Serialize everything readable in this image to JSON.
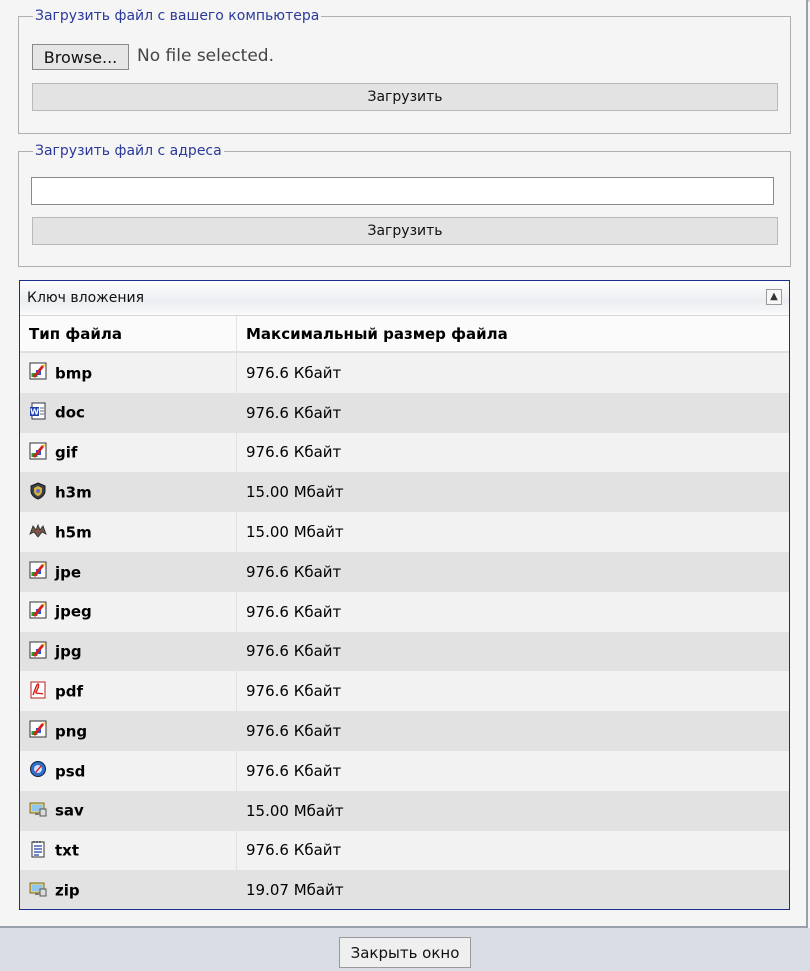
{
  "upload_local": {
    "legend": "Загрузить файл с вашего компьютера",
    "browse_label": "Browse...",
    "no_file_text": "No file selected.",
    "upload_label": "Загрузить"
  },
  "upload_url": {
    "legend": "Загрузить файл с адреса",
    "url_value": "",
    "upload_label": "Загрузить"
  },
  "attachment_panel": {
    "title": "Ключ вложения",
    "collapse_glyph": "▲",
    "columns": [
      "Тип файла",
      "Максимальный размер файла"
    ],
    "rows": [
      {
        "ext": "bmp",
        "size": "976.6 Кбайт",
        "icon": "image-icon"
      },
      {
        "ext": "doc",
        "size": "976.6 Кбайт",
        "icon": "word-doc-icon"
      },
      {
        "ext": "gif",
        "size": "976.6 Кбайт",
        "icon": "image-icon"
      },
      {
        "ext": "h3m",
        "size": "15.00 Мбайт",
        "icon": "shield-icon"
      },
      {
        "ext": "h5m",
        "size": "15.00 Мбайт",
        "icon": "creature-icon"
      },
      {
        "ext": "jpe",
        "size": "976.6 Кбайт",
        "icon": "image-icon"
      },
      {
        "ext": "jpeg",
        "size": "976.6 Кбайт",
        "icon": "image-icon"
      },
      {
        "ext": "jpg",
        "size": "976.6 Кбайт",
        "icon": "image-icon"
      },
      {
        "ext": "pdf",
        "size": "976.6 Кбайт",
        "icon": "pdf-icon"
      },
      {
        "ext": "png",
        "size": "976.6 Кбайт",
        "icon": "image-icon"
      },
      {
        "ext": "psd",
        "size": "976.6 Кбайт",
        "icon": "psd-icon"
      },
      {
        "ext": "sav",
        "size": "15.00 Мбайт",
        "icon": "monitor-icon"
      },
      {
        "ext": "txt",
        "size": "976.6 Кбайт",
        "icon": "text-file-icon"
      },
      {
        "ext": "zip",
        "size": "19.07 Мбайт",
        "icon": "monitor-icon"
      }
    ]
  },
  "footer": {
    "close_label": "Закрыть окно"
  }
}
